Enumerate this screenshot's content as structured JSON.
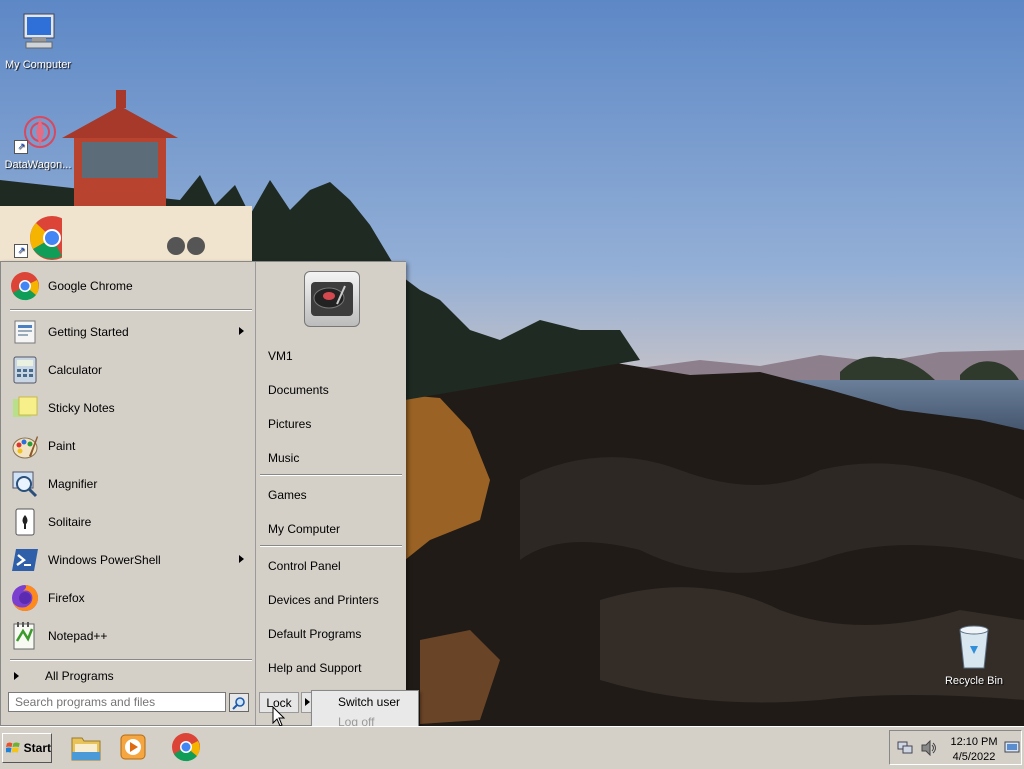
{
  "desktop": {
    "icons": [
      {
        "name": "My Computer"
      },
      {
        "name": "DataWagon..."
      },
      {
        "name": "Recycle Bin"
      }
    ]
  },
  "start_menu": {
    "pinned": [
      {
        "label": "Google Chrome",
        "icon": "chrome-icon"
      }
    ],
    "recent": [
      {
        "label": "Getting Started",
        "icon": "getting-started-icon",
        "submenu": true
      },
      {
        "label": "Calculator",
        "icon": "calculator-icon",
        "submenu": false
      },
      {
        "label": "Sticky Notes",
        "icon": "sticky-notes-icon",
        "submenu": false
      },
      {
        "label": "Paint",
        "icon": "paint-icon",
        "submenu": false
      },
      {
        "label": "Magnifier",
        "icon": "magnifier-icon",
        "submenu": false
      },
      {
        "label": "Solitaire",
        "icon": "solitaire-icon",
        "submenu": false
      },
      {
        "label": "Windows PowerShell",
        "icon": "powershell-icon",
        "submenu": true
      },
      {
        "label": "Firefox",
        "icon": "firefox-icon",
        "submenu": false
      },
      {
        "label": "Notepad++",
        "icon": "notepadpp-icon",
        "submenu": false
      }
    ],
    "all_programs": "All Programs",
    "search_placeholder": "Search programs and files",
    "right_items": [
      {
        "label": "VM1"
      },
      {
        "label": "Documents"
      },
      {
        "label": "Pictures"
      },
      {
        "label": "Music"
      },
      {
        "label": "Games"
      },
      {
        "label": "My Computer"
      },
      {
        "label": "Control Panel"
      },
      {
        "label": "Devices and Printers"
      },
      {
        "label": "Default Programs"
      },
      {
        "label": "Help and Support"
      }
    ],
    "lock_label": "Lock"
  },
  "power_flyout": {
    "items": [
      {
        "label": "Switch user",
        "enabled": true
      },
      {
        "label": "Log off",
        "enabled": false
      }
    ]
  },
  "taskbar": {
    "start_label": "Start",
    "pinned": [
      "file-explorer-icon",
      "media-player-icon",
      "chrome-icon"
    ],
    "clock_time": "12:10 PM",
    "clock_date": "4/5/2022"
  }
}
